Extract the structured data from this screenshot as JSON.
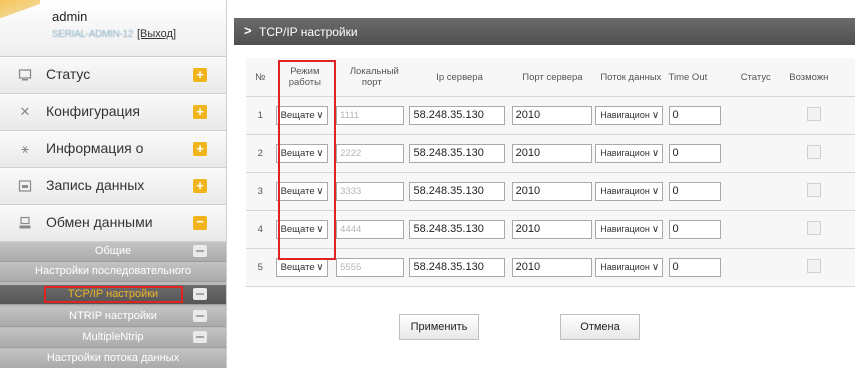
{
  "user": {
    "name": "admin",
    "id_masked": "SERIAL-ADMIN-12",
    "logout_label": "[Выход]"
  },
  "menu": [
    {
      "label": "Статус",
      "icon": "monitor-icon"
    },
    {
      "label": "Конфигурация",
      "icon": "tools-icon"
    },
    {
      "label": "Информация о",
      "icon": "satellite-icon"
    },
    {
      "label": "Запись данных",
      "icon": "storage-icon"
    },
    {
      "label": "Обмен данными",
      "icon": "data-exchange-icon"
    }
  ],
  "submenu": [
    {
      "label": "Общие"
    },
    {
      "label": "Настройки последовательного"
    },
    {
      "label": "TCP/IP настройки",
      "active": true
    },
    {
      "label": "NTRIP настройки"
    },
    {
      "label": "MultipleNtrip"
    },
    {
      "label": "Настройки потока данных"
    }
  ],
  "page": {
    "title": "TCP/IP настройки"
  },
  "table": {
    "headers": {
      "no": "№",
      "mode": "Режим работы",
      "local_port": "Локальный порт",
      "server_ip": "Ip сервера",
      "server_port": "Порт сервера",
      "data_stream": "Поток данных",
      "timeout": "Time Out",
      "status": "Статус",
      "enable": "Возможн"
    },
    "rows": [
      {
        "no": "1",
        "mode": "Вещате",
        "local_port": "1111",
        "server_ip": "58.248.35.130",
        "server_port": "2010",
        "data_stream": "Навигацион",
        "timeout": "0"
      },
      {
        "no": "2",
        "mode": "Вещате",
        "local_port": "2222",
        "server_ip": "58.248.35.130",
        "server_port": "2010",
        "data_stream": "Навигацион",
        "timeout": "0"
      },
      {
        "no": "3",
        "mode": "Вещате",
        "local_port": "3333",
        "server_ip": "58.248.35.130",
        "server_port": "2010",
        "data_stream": "Навигацион",
        "timeout": "0"
      },
      {
        "no": "4",
        "mode": "Вещате",
        "local_port": "4444",
        "server_ip": "58.248.35.130",
        "server_port": "2010",
        "data_stream": "Навигацион",
        "timeout": "0"
      },
      {
        "no": "5",
        "mode": "Вещате",
        "local_port": "5555",
        "server_ip": "58.248.35.130",
        "server_port": "2010",
        "data_stream": "Навигацион",
        "timeout": "0"
      }
    ]
  },
  "buttons": {
    "apply": "Применить",
    "cancel": "Отмена"
  },
  "colors": {
    "accent_plus": "#f1b51c",
    "highlight_red": "#e02424",
    "title_bar": "#5a5a5a"
  }
}
